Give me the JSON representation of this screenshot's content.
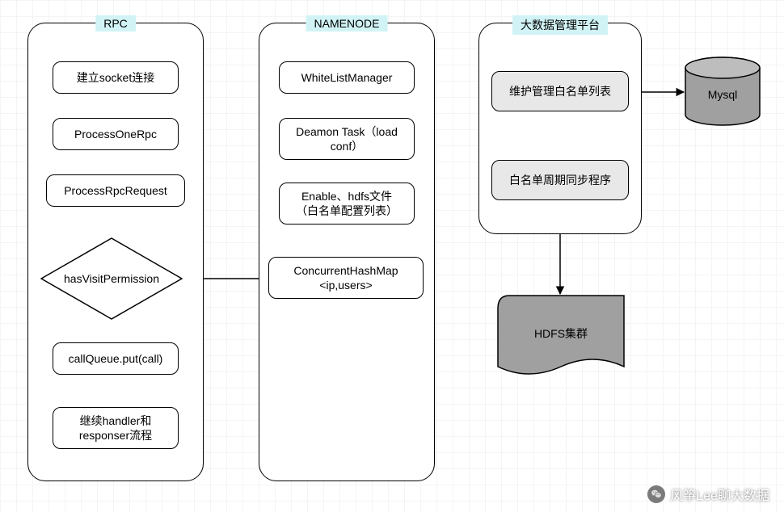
{
  "columns": {
    "rpc": {
      "title": "RPC",
      "nodes": {
        "socket": "建立socket连接",
        "processOne": "ProcessOneRpc",
        "processReq": "ProcessRpcRequest",
        "hasPerm": "hasVisitPermission",
        "callQueue": "callQueue.put(call)",
        "handler": "继续handler和\nresponser流程"
      }
    },
    "namenode": {
      "title": "NAMENODE",
      "nodes": {
        "wlm": "WhiteListManager",
        "deamon": "Deamon Task（load\nconf）",
        "enable": "Enable、hdfs文件\n（白名单配置列表）",
        "chm": "ConcurrentHashMap\n<ip,users>"
      }
    },
    "platform": {
      "title": "大数据管理平台",
      "nodes": {
        "maintain": "维护管理白名单列表",
        "sync": "白名单周期同步程序"
      }
    }
  },
  "external": {
    "mysql": "Mysql",
    "hdfs": "HDFS集群"
  },
  "watermark": "风筝Lee聊大数据"
}
